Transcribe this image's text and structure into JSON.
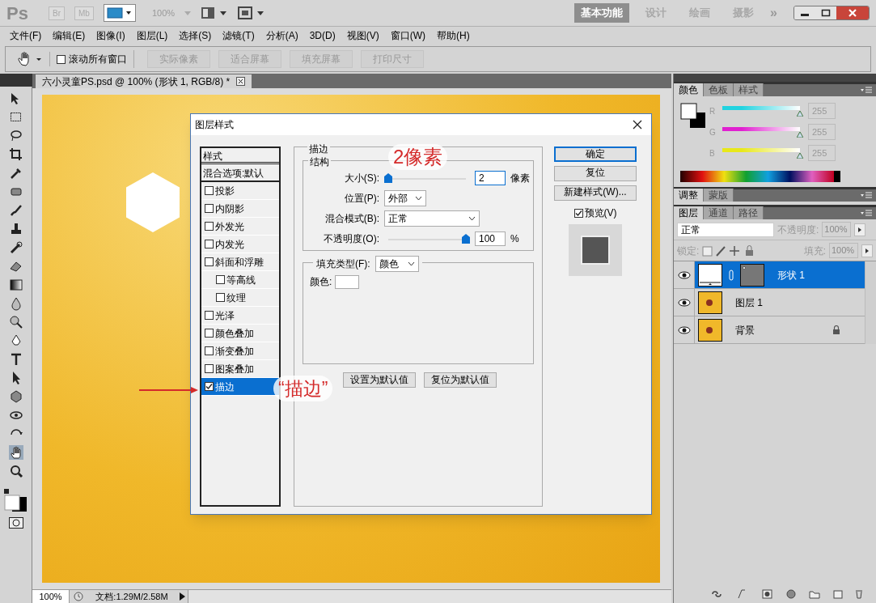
{
  "app_bar": {
    "logo": "Ps",
    "bridge": "Br",
    "mini_bridge": "Mb",
    "zoom": "100%",
    "workspaces": [
      {
        "label": "基本功能",
        "selected": true
      },
      {
        "label": "设计",
        "selected": false
      },
      {
        "label": "绘画",
        "selected": false
      },
      {
        "label": "摄影",
        "selected": false
      }
    ],
    "more": "»"
  },
  "menu": [
    "文件(F)",
    "编辑(E)",
    "图像(I)",
    "图层(L)",
    "选择(S)",
    "滤镜(T)",
    "分析(A)",
    "3D(D)",
    "视图(V)",
    "窗口(W)",
    "帮助(H)"
  ],
  "options_bar": {
    "scroll_all": {
      "label": "滚动所有窗口",
      "checked": false
    },
    "buttons": [
      "实际像素",
      "适合屏幕",
      "填充屏幕",
      "打印尺寸"
    ]
  },
  "document_tab": {
    "title": "六小灵童PS.psd @ 100% (形状 1, RGB/8) *"
  },
  "dialog": {
    "title": "图层样式",
    "styles_header": "样式",
    "blend_options": "混合选项:默认",
    "effects": [
      {
        "label": "投影",
        "checked": false,
        "selected": false
      },
      {
        "label": "内阴影",
        "checked": false,
        "selected": false
      },
      {
        "label": "外发光",
        "checked": false,
        "selected": false
      },
      {
        "label": "内发光",
        "checked": false,
        "selected": false
      },
      {
        "label": "斜面和浮雕",
        "checked": false,
        "selected": false,
        "children": [
          {
            "label": "等高线",
            "checked": false,
            "selected": false
          },
          {
            "label": "纹理",
            "checked": false,
            "selected": false
          }
        ]
      },
      {
        "label": "光泽",
        "checked": false,
        "selected": false
      },
      {
        "label": "颜色叠加",
        "checked": false,
        "selected": false
      },
      {
        "label": "渐变叠加",
        "checked": false,
        "selected": false
      },
      {
        "label": "图案叠加",
        "checked": false,
        "selected": false
      },
      {
        "label": "描边",
        "checked": true,
        "selected": true
      }
    ],
    "stroke": {
      "title": "描边",
      "structure": "结构",
      "size": {
        "label": "大小(S):",
        "level": 0.0,
        "value": "2",
        "unit": "像素"
      },
      "position_label": "位置(P):",
      "position_value": "外部",
      "blend_label": "混合模式(B):",
      "blend_value": "正常",
      "opacity": {
        "label": "不透明度(O):",
        "level": 1.0,
        "value": "100",
        "unit": "%"
      },
      "fill_type_label": "填充类型(F):",
      "fill_type_value": "颜色",
      "color_label": "颜色:",
      "color": "#ffffff"
    },
    "bottom_buttons": [
      "设置为默认值",
      "复位为默认值"
    ],
    "side_buttons": [
      {
        "label": "确定",
        "default": true
      },
      {
        "label": "复位",
        "default": false
      },
      {
        "label": "新建样式(W)...",
        "default": false
      }
    ],
    "preview": {
      "label": "预览(V)",
      "checked": true
    }
  },
  "annotations": [
    {
      "text": "2像素"
    },
    {
      "text": "“描边”"
    }
  ],
  "color_panel": {
    "tabs": [
      {
        "label": "颜色",
        "selected": true
      },
      {
        "label": "色板",
        "selected": false
      },
      {
        "label": "样式",
        "selected": false
      }
    ],
    "channels": [
      {
        "name": "R",
        "level": 1.0,
        "value": "255",
        "color": "#22d3e0"
      },
      {
        "name": "G",
        "level": 1.0,
        "value": "255",
        "color": "#e020d0"
      },
      {
        "name": "B",
        "level": 1.0,
        "value": "255",
        "color": "#e8e81a"
      }
    ]
  },
  "adjust_panel": {
    "tabs": [
      {
        "label": "调整",
        "selected": true
      },
      {
        "label": "蒙版",
        "selected": false
      }
    ]
  },
  "layers_panel": {
    "tabs": [
      {
        "label": "图层",
        "selected": true
      },
      {
        "label": "通道",
        "selected": false
      },
      {
        "label": "路径",
        "selected": false
      }
    ],
    "blend_mode": "正常",
    "opacity_label": "不透明度:",
    "opacity_value": "100%",
    "lock_label": "锁定:",
    "fill_label": "填充:",
    "fill_value": "100%",
    "layers": [
      {
        "name": "形状 1",
        "kind": "shape",
        "selected": true,
        "visible": true,
        "locked": false
      },
      {
        "name": "图层 1",
        "kind": "image",
        "selected": false,
        "visible": true,
        "locked": false
      },
      {
        "name": "背景",
        "kind": "image",
        "selected": false,
        "visible": true,
        "locked": true
      }
    ]
  },
  "status_bar": {
    "zoom": "100%",
    "doc_size": "文档:1.29M/2.58M"
  }
}
